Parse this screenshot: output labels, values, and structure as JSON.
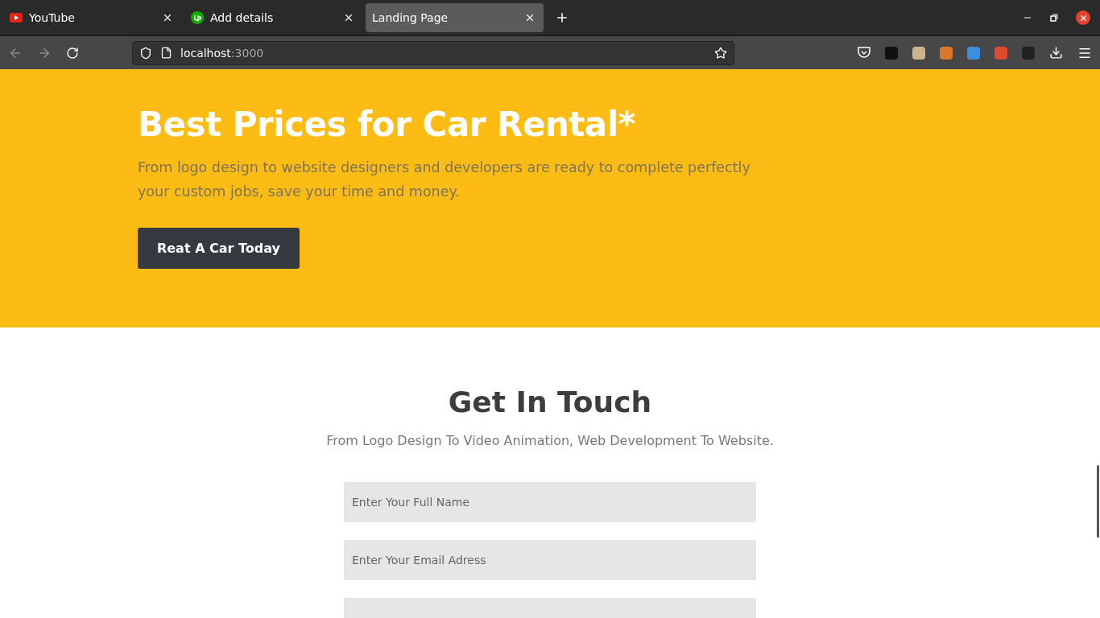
{
  "browser": {
    "tabs": [
      {
        "label": "YouTube",
        "kind": "youtube",
        "selected": false
      },
      {
        "label": "Add details",
        "kind": "upwork",
        "selected": false
      },
      {
        "label": "Landing Page",
        "kind": "plain",
        "selected": true
      }
    ],
    "address": {
      "host": "localhost",
      "port": ":3000"
    }
  },
  "hero": {
    "title": "Best Prices for Car Rental*",
    "text": "From logo design to website designers and developers are ready to complete perfectly your custom jobs, save your time and money.",
    "button": "Reat A Car Today"
  },
  "contact": {
    "title": "Get In Touch",
    "subtitle": "From Logo Design To Video Animation, Web Development To Website.",
    "fields": [
      {
        "kind": "input",
        "placeholder": "Enter Your Full Name"
      },
      {
        "kind": "input",
        "placeholder": "Enter Your Email Adress"
      },
      {
        "kind": "textarea"
      }
    ]
  }
}
